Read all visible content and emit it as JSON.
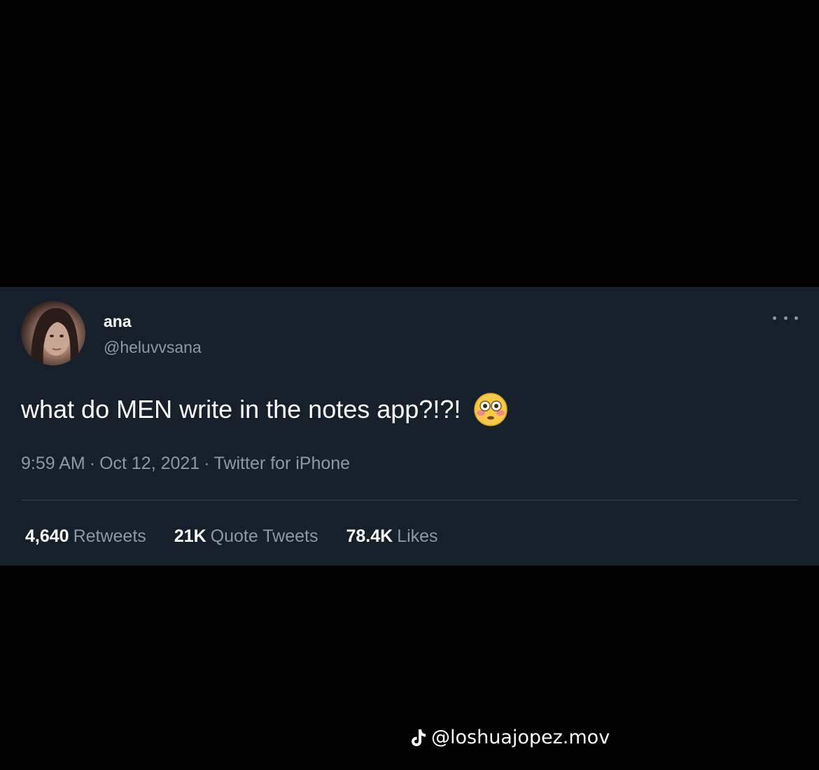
{
  "tweet": {
    "display_name": "ana",
    "handle": "@heluvvsana",
    "text": "what do MEN write in the notes app?!?!",
    "emoji": "flushed-face-emoji",
    "time": "9:59 AM",
    "date": "Oct 12, 2021",
    "source": "Twitter for iPhone",
    "separator": "·",
    "stats": {
      "retweets_count": "4,640",
      "retweets_label": "Retweets",
      "quotes_count": "21K",
      "quotes_label": "Quote Tweets",
      "likes_count": "78.4K",
      "likes_label": "Likes"
    }
  },
  "watermark": {
    "icon": "tiktok-icon",
    "text": "@loshuajopez.mov"
  },
  "colors": {
    "background": "#000000",
    "card": "#15202b",
    "primary_text": "#ffffff",
    "secondary_text": "#8b98a5",
    "divider": "#38444d"
  }
}
